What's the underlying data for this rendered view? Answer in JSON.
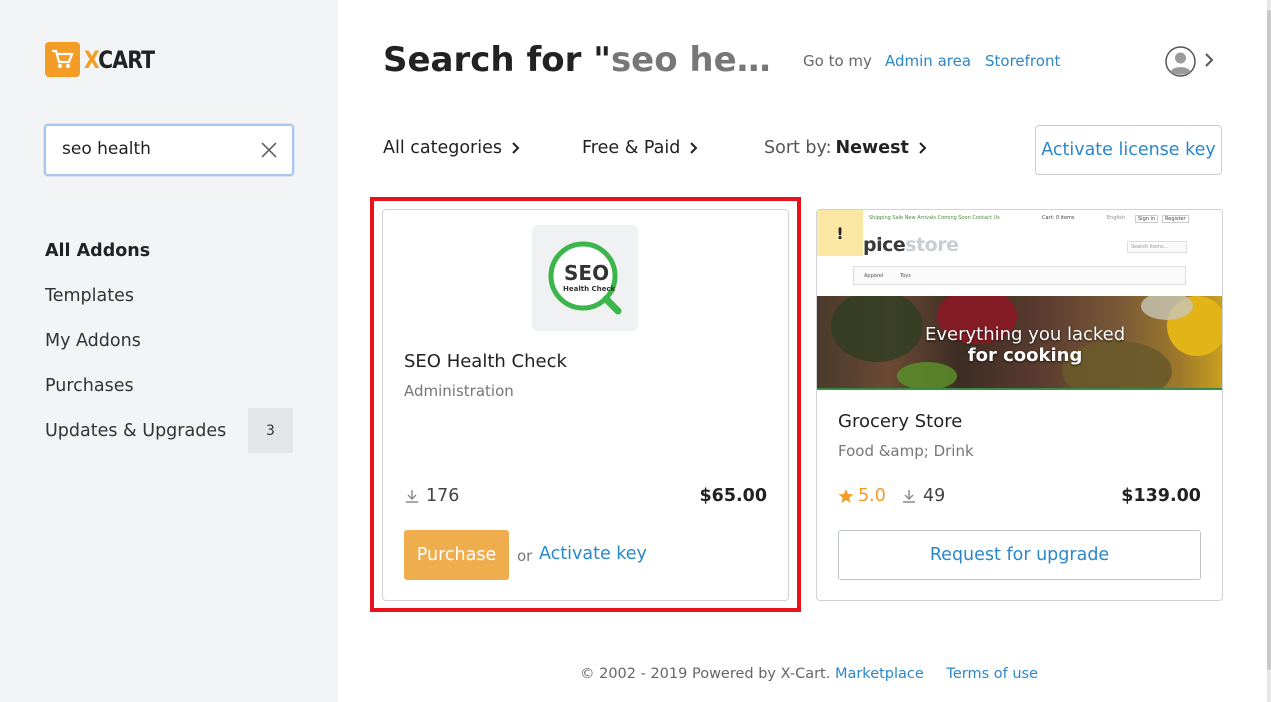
{
  "brand": {
    "logo_text_x": "X",
    "logo_text_rest": "CART",
    "accent": "#f39c26"
  },
  "search": {
    "value": "seo health",
    "clear_icon": "close-icon"
  },
  "sidebar": {
    "items": [
      {
        "label": "All Addons",
        "active": true
      },
      {
        "label": "Templates"
      },
      {
        "label": "My Addons"
      },
      {
        "label": "Purchases"
      },
      {
        "label": "Updates & Upgrades",
        "badge": "3"
      }
    ]
  },
  "header": {
    "title_prefix": "Search for \"",
    "title_query": "seo he…",
    "goto_label": "Go to my",
    "admin_link": "Admin area",
    "storefront_link": "Storefront"
  },
  "filters": {
    "categories": "All categories",
    "pricing": "Free & Paid",
    "sort_label": "Sort by:",
    "sort_value": "Newest",
    "license_button": "Activate license key"
  },
  "cards": [
    {
      "logo_text": "SEO",
      "logo_subtext": "Health Check",
      "title": "SEO Health Check",
      "category": "Administration",
      "downloads": "176",
      "price": "$65.00",
      "purchase_label": "Purchase",
      "or_label": "or",
      "activate_label": "Activate key",
      "logo_color": "#3cb54a"
    },
    {
      "warning": "!",
      "shot_logo_bold": "pice",
      "shot_logo_light": "store",
      "shot_nav": "Shipping  Sale  New Arrivals  Coming Soon  Contact Us",
      "shot_menu_1": "Apparel",
      "shot_menu_2": "Toys",
      "shot_cart": "Cart: 0 items",
      "shot_lang": "English",
      "shot_signin": "Sign in",
      "shot_register": "Register",
      "shot_search": "Search items...",
      "shot_banner_line1": "Everything you lacked",
      "shot_banner_line2": "for cooking",
      "title": "Grocery Store",
      "category": "Food &amp; Drink",
      "rating": "5.0",
      "downloads": "49",
      "price": "$139.00",
      "upgrade_label": "Request for upgrade"
    }
  ],
  "footer": {
    "copyright": "© 2002 - 2019 Powered by X-Cart.",
    "marketplace": "Marketplace",
    "terms": "Terms of use"
  }
}
